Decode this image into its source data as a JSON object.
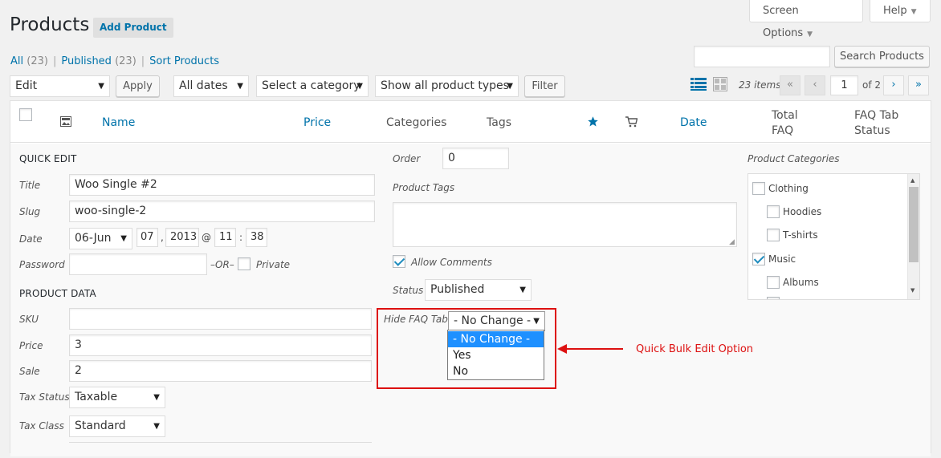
{
  "header": {
    "title": "Products",
    "add_button": "Add Product",
    "screen_options": "Screen Options",
    "help": "Help"
  },
  "views": {
    "all_label": "All",
    "all_count": "(23)",
    "published_label": "Published",
    "published_count": "(23)",
    "sort_label": "Sort Products",
    "separator": "|"
  },
  "search": {
    "value": "",
    "button": "Search Products"
  },
  "filters": {
    "bulk_action": "Edit",
    "apply": "Apply",
    "dates": "All dates",
    "category": "Select a category",
    "product_types": "Show all product types",
    "filter": "Filter"
  },
  "pagination": {
    "items": "23 items",
    "first": "«",
    "prev": "‹",
    "current_page": "1",
    "of_pages": "of 2",
    "next": "›",
    "last": "»"
  },
  "columns": {
    "name": "Name",
    "price": "Price",
    "categories": "Categories",
    "tags": "Tags",
    "date": "Date",
    "total_faq_1": "Total",
    "total_faq_2": "FAQ",
    "faq_status_1": "FAQ Tab",
    "faq_status_2": "Status"
  },
  "quick_edit": {
    "heading": "QUICK EDIT",
    "title_label": "Title",
    "title_value": "Woo Single #2",
    "slug_label": "Slug",
    "slug_value": "woo-single-2",
    "date_label": "Date",
    "month": "06-Jun",
    "day": "07",
    "comma": ",",
    "year": "2013",
    "at": "@",
    "hour": "11",
    "colon": ":",
    "minute": "38",
    "password_label": "Password",
    "password_value": "",
    "or_text": "–OR–",
    "private_label": "Private",
    "product_data_heading": "PRODUCT DATA",
    "sku_label": "SKU",
    "sku_value": "",
    "price_label": "Price",
    "price_value": "3",
    "sale_label": "Sale",
    "sale_value": "2",
    "tax_status_label": "Tax Status",
    "tax_status_value": "Taxable",
    "tax_class_label": "Tax Class",
    "tax_class_value": "Standard",
    "order_label": "Order",
    "order_value": "0",
    "tags_label": "Product Tags",
    "allow_comments": "Allow Comments",
    "status_label": "Status",
    "status_value": "Published",
    "hide_faq_label": "Hide FAQ Tab?",
    "hide_faq_value": "- No Change -",
    "hide_faq_options": [
      "- No Change -",
      "Yes",
      "No"
    ],
    "categories_label": "Product Categories",
    "categories": [
      {
        "name": "Clothing",
        "checked": false
      },
      {
        "name": "Hoodies",
        "checked": false
      },
      {
        "name": "T-shirts",
        "checked": false
      },
      {
        "name": "Music",
        "checked": true
      },
      {
        "name": "Albums",
        "checked": false
      }
    ]
  },
  "annotation": {
    "text": "Quick  Bulk Edit Option",
    "color": "#dd1111"
  },
  "colors": {
    "link": "#0073aa",
    "dropdown_selected": "#1e90ff"
  }
}
